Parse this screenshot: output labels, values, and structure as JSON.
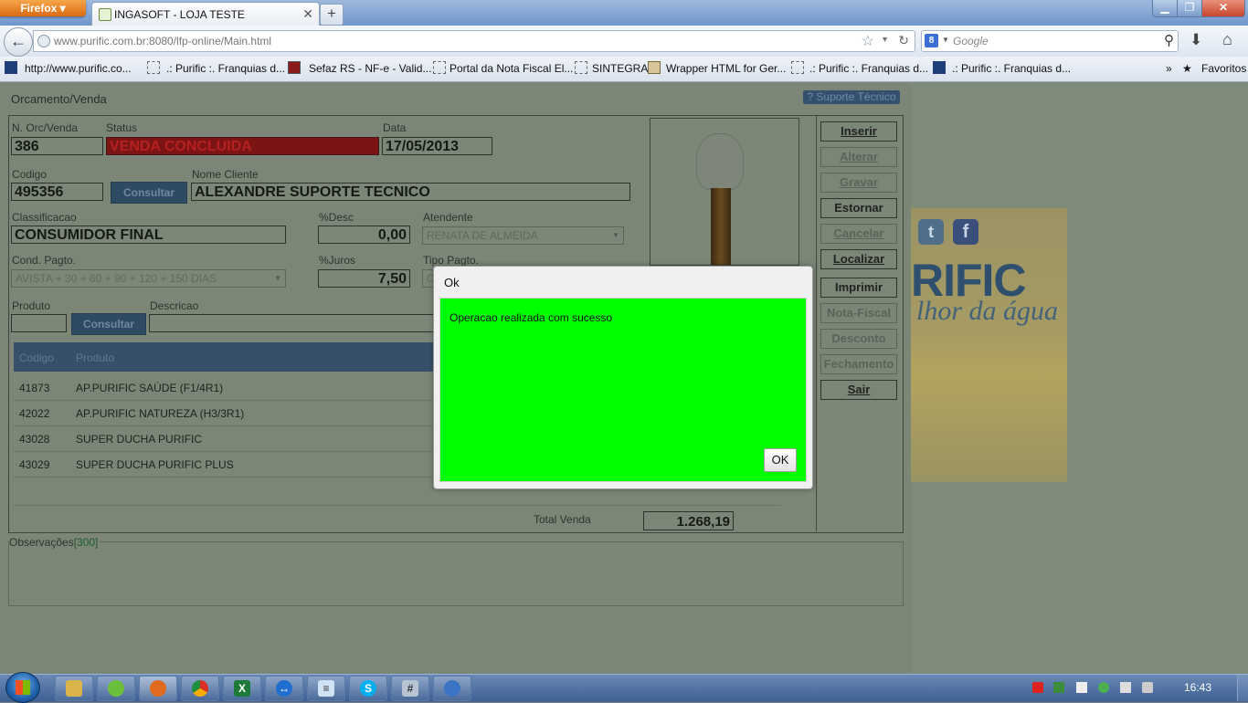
{
  "browser": {
    "app_button": "Firefox",
    "tab_title": "INGASOFT - LOJA TESTE",
    "url_host": "www.purific.com.br",
    "url_rest": ":8080/lfp-online/Main.html",
    "search_placeholder": "Google",
    "bookmarks": [
      "http://www.purific.co...",
      ".: Purific :. Franquias d...",
      "Sefaz RS - NF-e - Valid...",
      "Portal da Nota Fiscal El...",
      "SINTEGRA",
      "Wrapper HTML for Ger...",
      ".: Purific :. Franquias d...",
      ".: Purific :. Franquias d..."
    ],
    "favorites_label": "Favoritos",
    "more_label": "»"
  },
  "app": {
    "window_title": "Orcamento/Venda",
    "support_button": "? Suporte Técnico",
    "labels": {
      "orc": "N. Orc/Venda",
      "status": "Status",
      "data": "Data",
      "codigo": "Codigo",
      "nome_cliente": "Nome Cliente",
      "classificacao": "Classificacao",
      "desc": "%Desc",
      "atendente": "Atendente",
      "cond_pagto": "Cond. Pagto.",
      "juros": "%Juros",
      "tipo_pagto": "Tipo Pagto.",
      "produto": "Produto",
      "descricao": "Descricao",
      "consultar": "Consultar",
      "total_venda": "Total Venda",
      "observacoes": "Observações",
      "obs_count": "[300]"
    },
    "values": {
      "orc": "386",
      "status": "VENDA CONCLUIDA",
      "data": "17/05/2013",
      "codigo": "495356",
      "nome_cliente": "ALEXANDRE SUPORTE TECNICO",
      "classificacao": "CONSUMIDOR FINAL",
      "desc": "0,00",
      "atendente": "RENATA DE ALMEIDA",
      "cond_pagto": "AVISTA + 30 + 60 + 90 + 120 + 150 DIAS",
      "juros": "7,50",
      "tipo_pagto": "C",
      "total_venda": "1.268,19"
    },
    "table": {
      "headers": [
        "Codigo",
        "Produto"
      ],
      "rows": [
        [
          "41873",
          "AP.PURIFIC SAÚDE (F1/4R1)"
        ],
        [
          "42022",
          "AP.PURIFIC NATUREZA (H3/3R1)"
        ],
        [
          "43028",
          "SUPER DUCHA PURIFIC"
        ],
        [
          "43029",
          "SUPER DUCHA PURIFIC PLUS"
        ]
      ]
    },
    "side_buttons": [
      "Inserir",
      "Alterar",
      "Gravar",
      "Estornar",
      "Cancelar",
      "Localizar",
      "Imprimir",
      "Nota-Fiscal",
      "Desconto",
      "Fechamento",
      "Sair"
    ]
  },
  "promo": {
    "brand": "RIFIC",
    "slogan": "lhor da água",
    "tw": "t",
    "fb": "f"
  },
  "dialog": {
    "title": "Ok",
    "message": "Operacao realizada com sucesso",
    "ok_button": "OK",
    "body_color": "#00ff00"
  },
  "taskbar": {
    "clock": "16:43",
    "apps": [
      "explorer",
      "apps",
      "firefox",
      "chrome",
      "excel",
      "teamviewer",
      "notepad",
      "skype",
      "calculator",
      "network"
    ]
  }
}
